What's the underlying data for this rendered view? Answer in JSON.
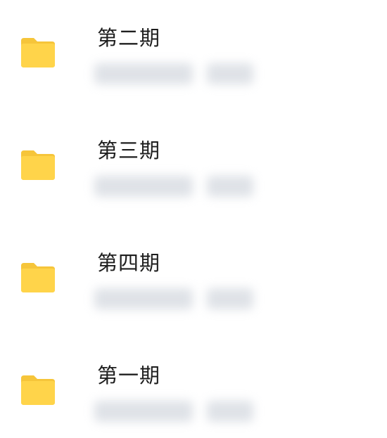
{
  "folders": [
    {
      "title": "第二期",
      "icon": "folder-icon",
      "color": "#FFD44A"
    },
    {
      "title": "第三期",
      "icon": "folder-icon",
      "color": "#FFD44A"
    },
    {
      "title": "第四期",
      "icon": "folder-icon",
      "color": "#FFD44A"
    },
    {
      "title": "第一期",
      "icon": "folder-icon",
      "color": "#FFD44A"
    }
  ]
}
